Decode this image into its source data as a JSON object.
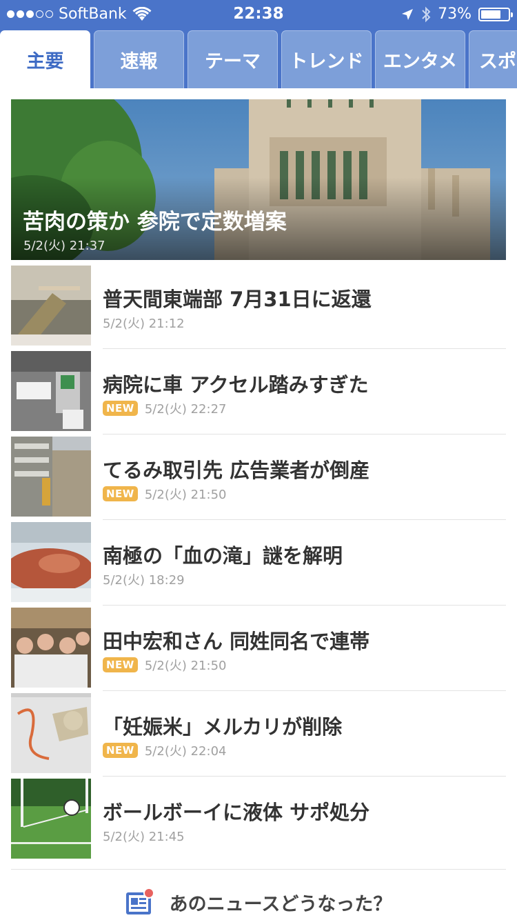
{
  "status_bar": {
    "carrier": "SoftBank",
    "time": "22:38",
    "battery": "73%",
    "battery_level": 0.73,
    "signal_bars_filled": 3,
    "signal_bars_total": 5
  },
  "tabs": [
    {
      "label": "主要",
      "active": true
    },
    {
      "label": "速報",
      "active": false
    },
    {
      "label": "テーマ",
      "active": false
    },
    {
      "label": "トレンド",
      "active": false
    },
    {
      "label": "エンタメ",
      "active": false
    },
    {
      "label": "スポー",
      "active": false
    }
  ],
  "hero": {
    "title": "苦肉の策か 参院で定数増案",
    "date": "5/2(火) 21:37"
  },
  "articles": [
    {
      "title": "普天間東端部 7月31日に返還",
      "date": "5/2(火) 21:12",
      "new": false
    },
    {
      "title": "病院に車 アクセル踏みすぎた",
      "date": "5/2(火) 22:27",
      "new": true
    },
    {
      "title": "てるみ取引先 広告業者が倒産",
      "date": "5/2(火) 21:50",
      "new": true
    },
    {
      "title": "南極の「血の滝」謎を解明",
      "date": "5/2(火) 18:29",
      "new": false
    },
    {
      "title": "田中宏和さん 同姓同名で連帯",
      "date": "5/2(火) 21:50",
      "new": true
    },
    {
      "title": "「妊娠米」メルカリが削除",
      "date": "5/2(火) 22:04",
      "new": true
    },
    {
      "title": "ボールボーイに液体 サポ処分",
      "date": "5/2(火) 21:45",
      "new": false
    }
  ],
  "badge_label": "NEW",
  "footer": {
    "label": "あのニュースどうなった？"
  },
  "colors": {
    "accent": "#4a74c9",
    "tab_inactive": "#7d9fd9",
    "badge": "#f0b54b",
    "notification_dot": "#e8625f"
  }
}
